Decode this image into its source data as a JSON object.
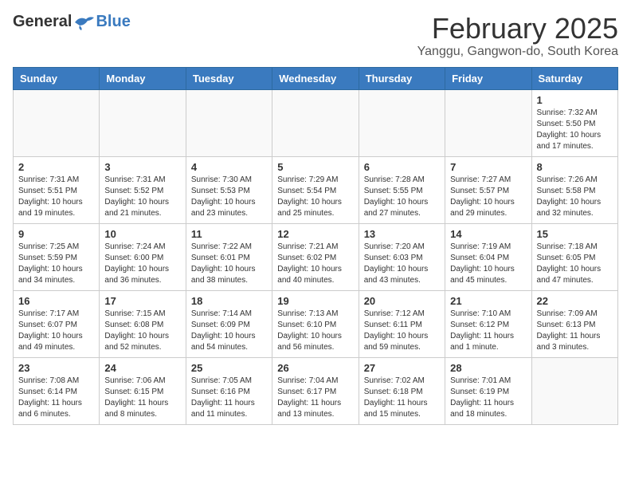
{
  "header": {
    "logo_general": "General",
    "logo_blue": "Blue",
    "month_title": "February 2025",
    "location": "Yanggu, Gangwon-do, South Korea"
  },
  "weekdays": [
    "Sunday",
    "Monday",
    "Tuesday",
    "Wednesday",
    "Thursday",
    "Friday",
    "Saturday"
  ],
  "weeks": [
    [
      {
        "day": "",
        "info": ""
      },
      {
        "day": "",
        "info": ""
      },
      {
        "day": "",
        "info": ""
      },
      {
        "day": "",
        "info": ""
      },
      {
        "day": "",
        "info": ""
      },
      {
        "day": "",
        "info": ""
      },
      {
        "day": "1",
        "info": "Sunrise: 7:32 AM\nSunset: 5:50 PM\nDaylight: 10 hours and 17 minutes."
      }
    ],
    [
      {
        "day": "2",
        "info": "Sunrise: 7:31 AM\nSunset: 5:51 PM\nDaylight: 10 hours and 19 minutes."
      },
      {
        "day": "3",
        "info": "Sunrise: 7:31 AM\nSunset: 5:52 PM\nDaylight: 10 hours and 21 minutes."
      },
      {
        "day": "4",
        "info": "Sunrise: 7:30 AM\nSunset: 5:53 PM\nDaylight: 10 hours and 23 minutes."
      },
      {
        "day": "5",
        "info": "Sunrise: 7:29 AM\nSunset: 5:54 PM\nDaylight: 10 hours and 25 minutes."
      },
      {
        "day": "6",
        "info": "Sunrise: 7:28 AM\nSunset: 5:55 PM\nDaylight: 10 hours and 27 minutes."
      },
      {
        "day": "7",
        "info": "Sunrise: 7:27 AM\nSunset: 5:57 PM\nDaylight: 10 hours and 29 minutes."
      },
      {
        "day": "8",
        "info": "Sunrise: 7:26 AM\nSunset: 5:58 PM\nDaylight: 10 hours and 32 minutes."
      }
    ],
    [
      {
        "day": "9",
        "info": "Sunrise: 7:25 AM\nSunset: 5:59 PM\nDaylight: 10 hours and 34 minutes."
      },
      {
        "day": "10",
        "info": "Sunrise: 7:24 AM\nSunset: 6:00 PM\nDaylight: 10 hours and 36 minutes."
      },
      {
        "day": "11",
        "info": "Sunrise: 7:22 AM\nSunset: 6:01 PM\nDaylight: 10 hours and 38 minutes."
      },
      {
        "day": "12",
        "info": "Sunrise: 7:21 AM\nSunset: 6:02 PM\nDaylight: 10 hours and 40 minutes."
      },
      {
        "day": "13",
        "info": "Sunrise: 7:20 AM\nSunset: 6:03 PM\nDaylight: 10 hours and 43 minutes."
      },
      {
        "day": "14",
        "info": "Sunrise: 7:19 AM\nSunset: 6:04 PM\nDaylight: 10 hours and 45 minutes."
      },
      {
        "day": "15",
        "info": "Sunrise: 7:18 AM\nSunset: 6:05 PM\nDaylight: 10 hours and 47 minutes."
      }
    ],
    [
      {
        "day": "16",
        "info": "Sunrise: 7:17 AM\nSunset: 6:07 PM\nDaylight: 10 hours and 49 minutes."
      },
      {
        "day": "17",
        "info": "Sunrise: 7:15 AM\nSunset: 6:08 PM\nDaylight: 10 hours and 52 minutes."
      },
      {
        "day": "18",
        "info": "Sunrise: 7:14 AM\nSunset: 6:09 PM\nDaylight: 10 hours and 54 minutes."
      },
      {
        "day": "19",
        "info": "Sunrise: 7:13 AM\nSunset: 6:10 PM\nDaylight: 10 hours and 56 minutes."
      },
      {
        "day": "20",
        "info": "Sunrise: 7:12 AM\nSunset: 6:11 PM\nDaylight: 10 hours and 59 minutes."
      },
      {
        "day": "21",
        "info": "Sunrise: 7:10 AM\nSunset: 6:12 PM\nDaylight: 11 hours and 1 minute."
      },
      {
        "day": "22",
        "info": "Sunrise: 7:09 AM\nSunset: 6:13 PM\nDaylight: 11 hours and 3 minutes."
      }
    ],
    [
      {
        "day": "23",
        "info": "Sunrise: 7:08 AM\nSunset: 6:14 PM\nDaylight: 11 hours and 6 minutes."
      },
      {
        "day": "24",
        "info": "Sunrise: 7:06 AM\nSunset: 6:15 PM\nDaylight: 11 hours and 8 minutes."
      },
      {
        "day": "25",
        "info": "Sunrise: 7:05 AM\nSunset: 6:16 PM\nDaylight: 11 hours and 11 minutes."
      },
      {
        "day": "26",
        "info": "Sunrise: 7:04 AM\nSunset: 6:17 PM\nDaylight: 11 hours and 13 minutes."
      },
      {
        "day": "27",
        "info": "Sunrise: 7:02 AM\nSunset: 6:18 PM\nDaylight: 11 hours and 15 minutes."
      },
      {
        "day": "28",
        "info": "Sunrise: 7:01 AM\nSunset: 6:19 PM\nDaylight: 11 hours and 18 minutes."
      },
      {
        "day": "",
        "info": ""
      }
    ]
  ]
}
